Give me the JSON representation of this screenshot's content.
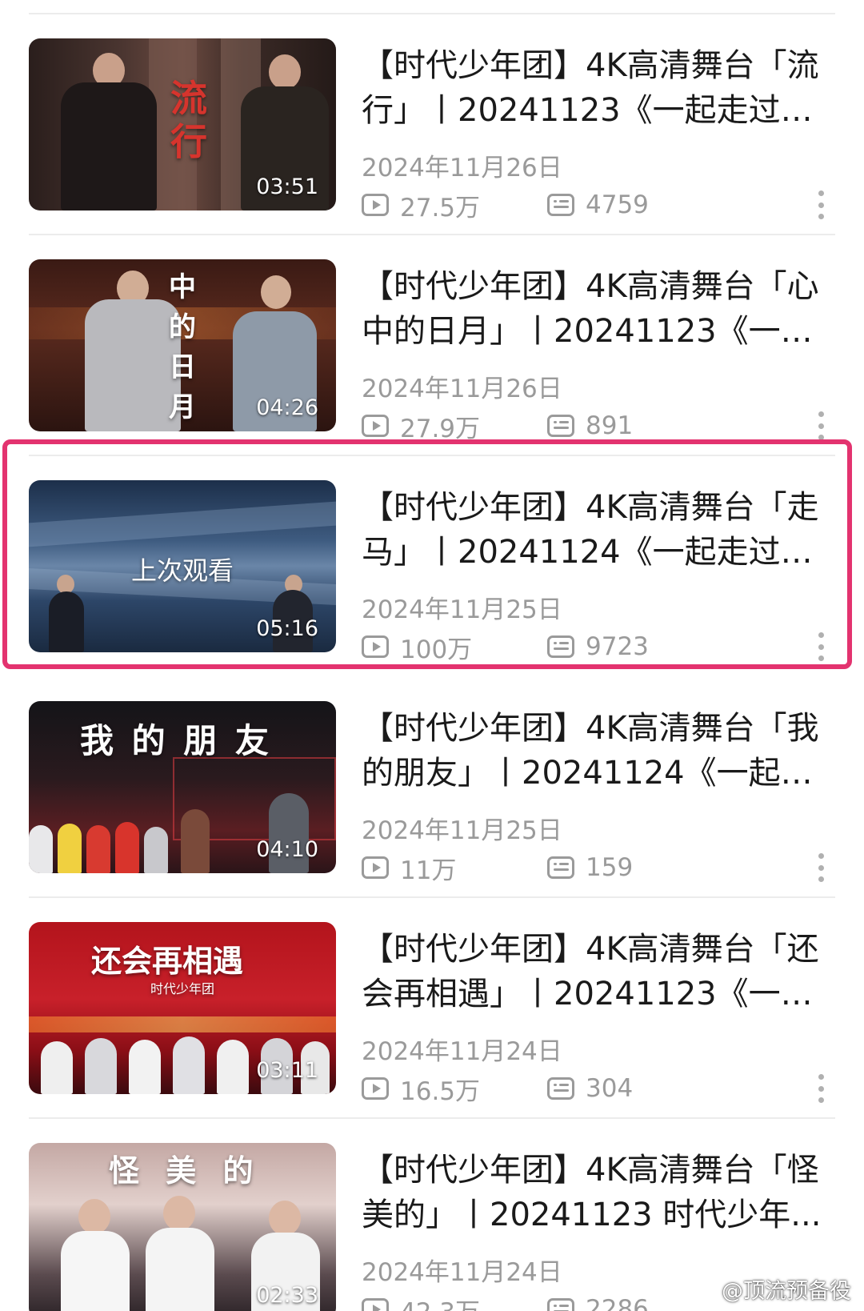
{
  "videos": [
    {
      "title": "【时代少年团】4K高清舞台「流行」丨20241123《一起走过的...",
      "date": "2024年11月26日",
      "views": "27.5万",
      "danmaku": "4759",
      "duration": "03:51",
      "thumb_text": "流行",
      "last_watched": ""
    },
    {
      "title": "【时代少年团】4K高清舞台「心中的日月」丨20241123《一起...",
      "date": "2024年11月26日",
      "views": "27.9万",
      "danmaku": "891",
      "duration": "04:26",
      "thumb_text": "中的日月",
      "last_watched": ""
    },
    {
      "title": "【时代少年团】4K高清舞台「走马」丨20241124《一起走过的...",
      "date": "2024年11月25日",
      "views": "100万",
      "danmaku": "9723",
      "duration": "05:16",
      "thumb_text": "",
      "last_watched": "上次观看"
    },
    {
      "title": "【时代少年团】4K高清舞台「我的朋友」丨20241124《一起走...",
      "date": "2024年11月25日",
      "views": "11万",
      "danmaku": "159",
      "duration": "04:10",
      "thumb_text": "我 的 朋 友",
      "last_watched": ""
    },
    {
      "title": "【时代少年团】4K高清舞台「还会再相遇」丨20241123《一起...",
      "date": "2024年11月24日",
      "views": "16.5万",
      "danmaku": "304",
      "duration": "03:11",
      "thumb_text": "还会再相遇",
      "thumb_subtext": "时代少年团",
      "last_watched": ""
    },
    {
      "title": "【时代少年团】4K高清舞台「怪美的」丨20241123 时代少年...",
      "date": "2024年11月24日",
      "views": "42.3万",
      "danmaku": "2286",
      "duration": "02:33",
      "thumb_text": "怪 美 的",
      "last_watched": ""
    }
  ],
  "watermark": "@顶流预备役",
  "colors": {
    "highlight": "#e3336f",
    "meta_text": "#9a9a9a",
    "title_text": "#1a1a1a"
  },
  "icons": {
    "views": "play-count-icon",
    "danmaku": "danmaku-count-icon",
    "more": "more-vertical-icon"
  }
}
